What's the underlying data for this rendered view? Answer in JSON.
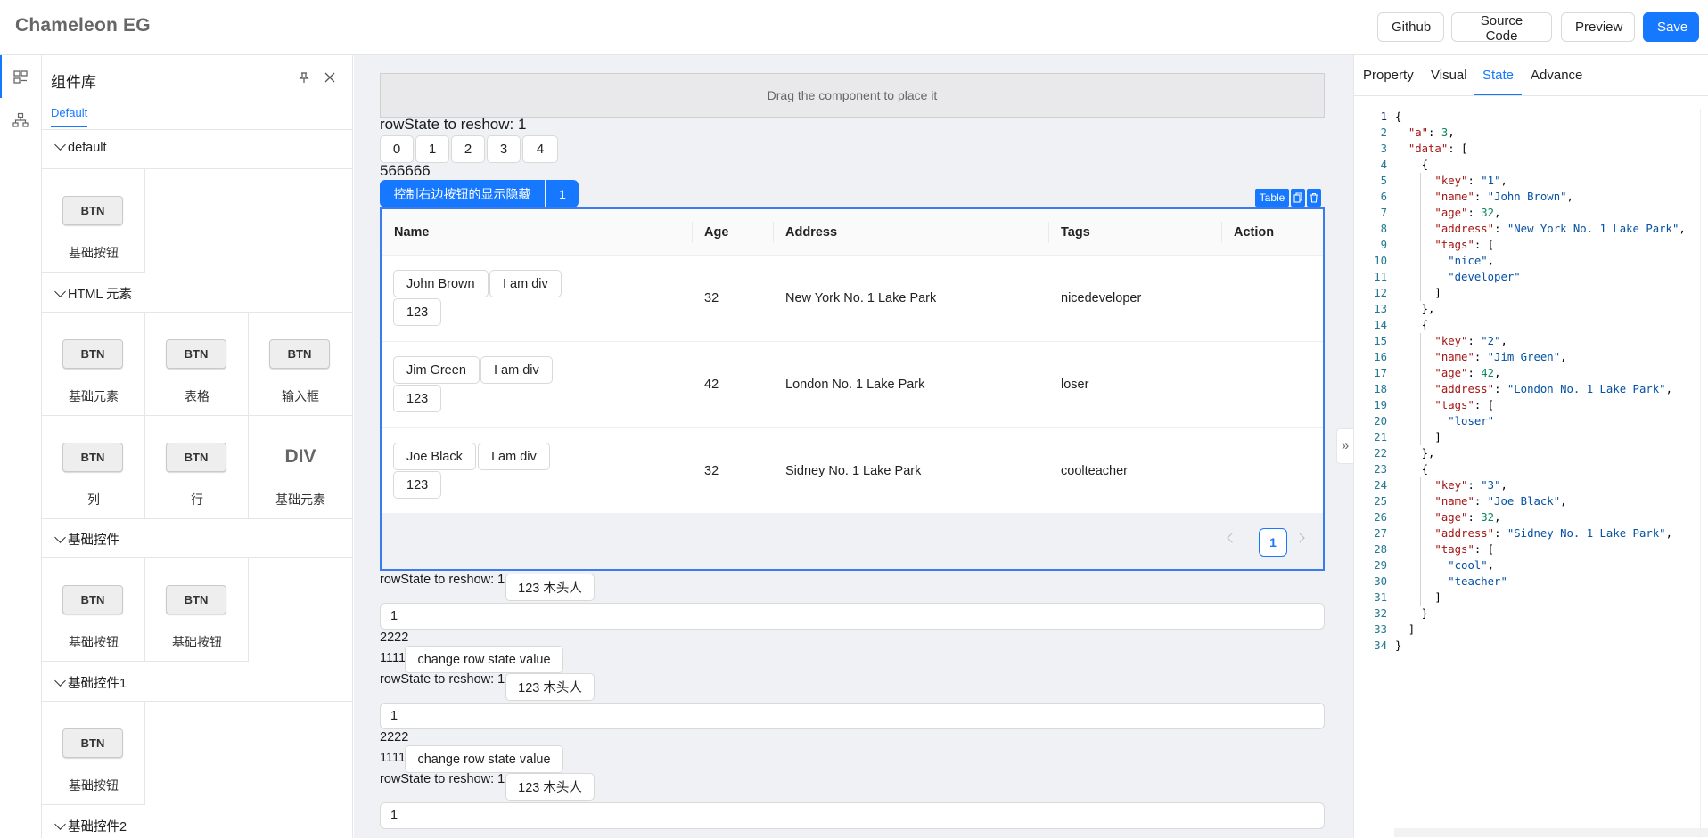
{
  "header": {
    "title": "Chameleon EG",
    "buttons": {
      "github": "Github",
      "source": "Source Code",
      "preview": "Preview",
      "save": "Save"
    }
  },
  "library": {
    "title": "组件库",
    "tab": "Default",
    "groups": [
      {
        "name": "default",
        "items": [
          {
            "chip": "BTN",
            "label": "基础按钮"
          }
        ]
      },
      {
        "name": "HTML 元素",
        "items": [
          {
            "chip": "BTN",
            "label": "基础元素"
          },
          {
            "chip": "BTN",
            "label": "表格"
          },
          {
            "chip": "BTN",
            "label": "输入框"
          },
          {
            "chip": "BTN",
            "label": "列"
          },
          {
            "chip": "BTN",
            "label": "行"
          },
          {
            "chip": "DIV",
            "label": "基础元素"
          }
        ]
      },
      {
        "name": "基础控件",
        "items": [
          {
            "chip": "BTN",
            "label": "基础按钮"
          },
          {
            "chip": "BTN",
            "label": "基础按钮"
          }
        ]
      },
      {
        "name": "基础控件1",
        "items": [
          {
            "chip": "BTN",
            "label": "基础按钮"
          }
        ]
      },
      {
        "name": "基础控件2",
        "items": []
      }
    ]
  },
  "canvas": {
    "dropzone": "Drag the component to place it",
    "row_state_line": "rowState to reshow: 1",
    "number_buttons": [
      "0",
      "1",
      "2",
      "3",
      "4"
    ],
    "text_566666": "566666",
    "toggle_button": "控制右边按钮的显示隐藏",
    "toggle_count": "1",
    "table_tag": "Table",
    "table": {
      "columns": [
        "Name",
        "Age",
        "Address",
        "Tags",
        "Action"
      ],
      "rows": [
        {
          "name": "John Brown",
          "div": "I am div",
          "num": "123",
          "age": "32",
          "address": "New York No. 1 Lake Park",
          "tags": "nicedeveloper"
        },
        {
          "name": "Jim Green",
          "div": "I am div",
          "num": "123",
          "age": "42",
          "address": "London No. 1 Lake Park",
          "tags": "loser"
        },
        {
          "name": "Joe Black",
          "div": "I am div",
          "num": "123",
          "age": "32",
          "address": "Sidney No. 1 Lake Park",
          "tags": "coolteacher"
        }
      ],
      "page": "1"
    },
    "blocks": [
      {
        "label": "rowState to reshow: 1",
        "btn": "123 木头人",
        "input": "1",
        "t2222": "2222",
        "t1111": "1111",
        "change": "change row state value"
      },
      {
        "label": "rowState to reshow: 1",
        "btn": "123 木头人",
        "input": "1",
        "t2222": "2222",
        "t1111": "1111",
        "change": "change row state value"
      },
      {
        "label": "rowState to reshow: 1",
        "btn": "123 木头人",
        "input": "1"
      }
    ],
    "collapse_glyph": "»"
  },
  "right": {
    "tabs": [
      "Property",
      "Visual",
      "State",
      "Advance"
    ],
    "active_tab": "State",
    "code_lines": [
      "{",
      "  \"a\": 3,",
      "  \"data\": [",
      "    {",
      "      \"key\": \"1\",",
      "      \"name\": \"John Brown\",",
      "      \"age\": 32,",
      "      \"address\": \"New York No. 1 Lake Park\",",
      "      \"tags\": [",
      "        \"nice\",",
      "        \"developer\"",
      "      ]",
      "    },",
      "    {",
      "      \"key\": \"2\",",
      "      \"name\": \"Jim Green\",",
      "      \"age\": 42,",
      "      \"address\": \"London No. 1 Lake Park\",",
      "      \"tags\": [",
      "        \"loser\"",
      "      ]",
      "    },",
      "    {",
      "      \"key\": \"3\",",
      "      \"name\": \"Joe Black\",",
      "      \"age\": 32,",
      "      \"address\": \"Sidney No. 1 Lake Park\",",
      "      \"tags\": [",
      "        \"cool\",",
      "        \"teacher\"",
      "      ]",
      "    }",
      "  ]",
      "}"
    ]
  },
  "colors": {
    "accent": "#1677ff",
    "canvas_bg": "#f0f1f5",
    "selected_border": "#3a7cf0"
  },
  "icons": {
    "rail_top": "component-icon",
    "rail_bottom": "tree-icon",
    "pin": "pin-icon",
    "close": "close-icon",
    "copy": "copy-icon",
    "delete": "delete-icon"
  }
}
